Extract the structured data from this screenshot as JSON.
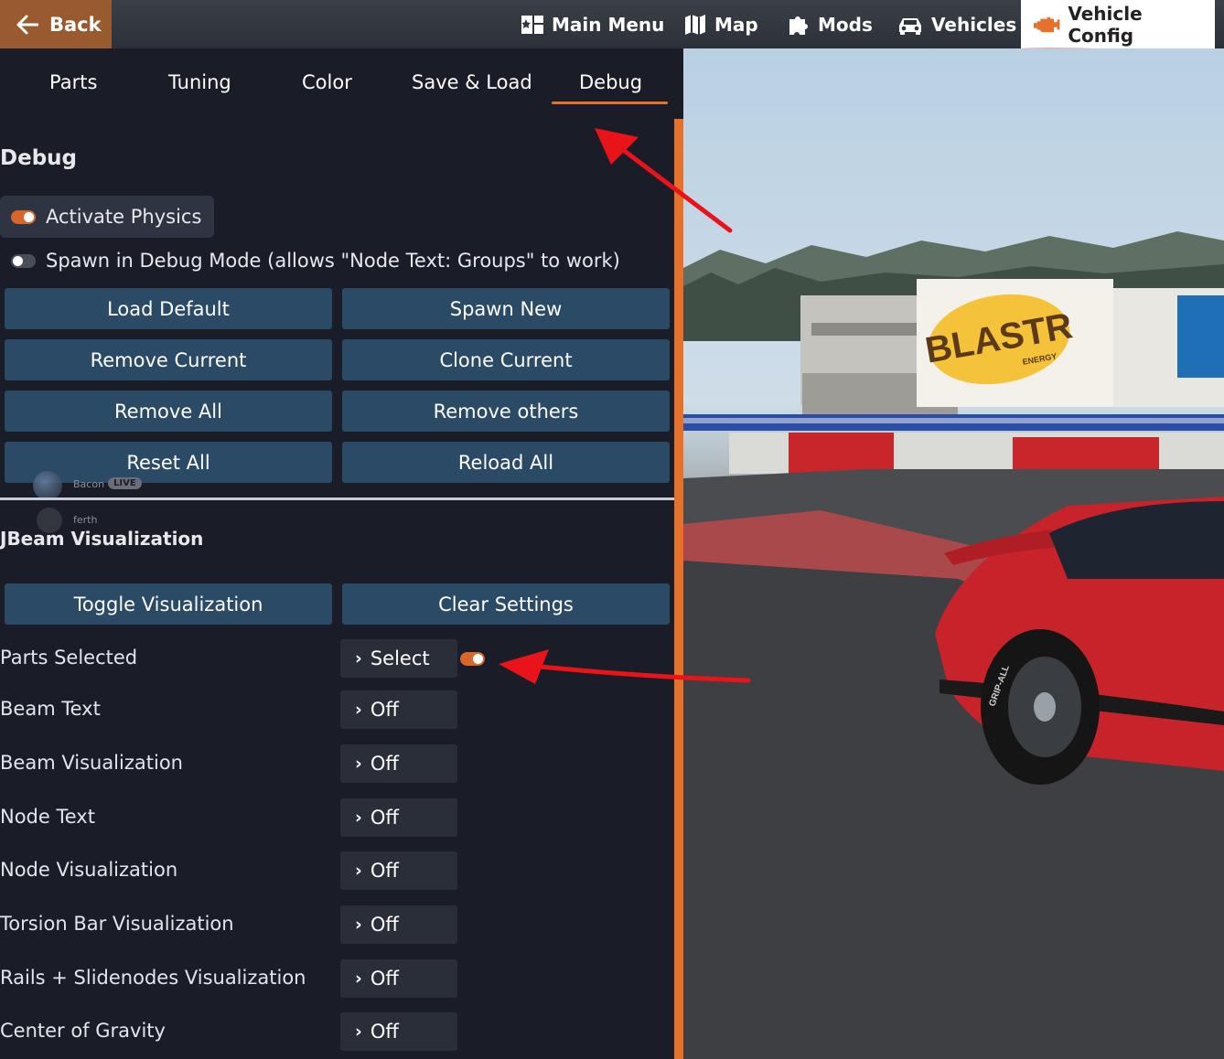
{
  "topbar": {
    "back_label": "Back",
    "nav": {
      "main_menu": "Main Menu",
      "map": "Map",
      "mods": "Mods",
      "vehicles": "Vehicles",
      "vehicle_config": "Vehicle Config"
    }
  },
  "tabs": {
    "parts": "Parts",
    "tuning": "Tuning",
    "color": "Color",
    "save_load": "Save & Load",
    "debug": "Debug",
    "active": "Debug"
  },
  "debug": {
    "title": "Debug",
    "activate_physics": {
      "label": "Activate Physics",
      "on": true
    },
    "spawn_debug": {
      "label": "Spawn in Debug Mode (allows \"Node Text: Groups\" to work)",
      "on": false
    },
    "buttons": {
      "load_default": "Load Default",
      "spawn_new": "Spawn New",
      "remove_current": "Remove Current",
      "clone_current": "Clone Current",
      "remove_all": "Remove All",
      "remove_others": "Remove others",
      "reset_all": "Reset All",
      "reload_all": "Reload All"
    }
  },
  "overlay": {
    "user1": "Bacon",
    "live": "LIVE",
    "user2": "ferth"
  },
  "jbeam": {
    "title": "JBeam Visualization",
    "toggle_label": "Toggle Visualization",
    "clear_label": "Clear Settings",
    "rows": [
      {
        "label": "Parts Selected",
        "value": "Select"
      },
      {
        "label": "Beam Text",
        "value": "Off"
      },
      {
        "label": "Beam Visualization",
        "value": "Off"
      },
      {
        "label": "Node Text",
        "value": "Off"
      },
      {
        "label": "Node Visualization",
        "value": "Off"
      },
      {
        "label": "Torsion Bar Visualization",
        "value": "Off"
      },
      {
        "label": "Rails + Slidenodes Visualization",
        "value": "Off"
      },
      {
        "label": "Center of Gravity",
        "value": "Off"
      }
    ],
    "parts_selected_toggle": true
  },
  "scene": {
    "billboard": "BLASTR",
    "billboard_sub": "ENERGY",
    "tire_text": "GRIP-ALL"
  },
  "colors": {
    "accent": "#e5712a",
    "button": "#2b4a66",
    "panel": "#1a1d27",
    "annotation": "#e8141a"
  }
}
